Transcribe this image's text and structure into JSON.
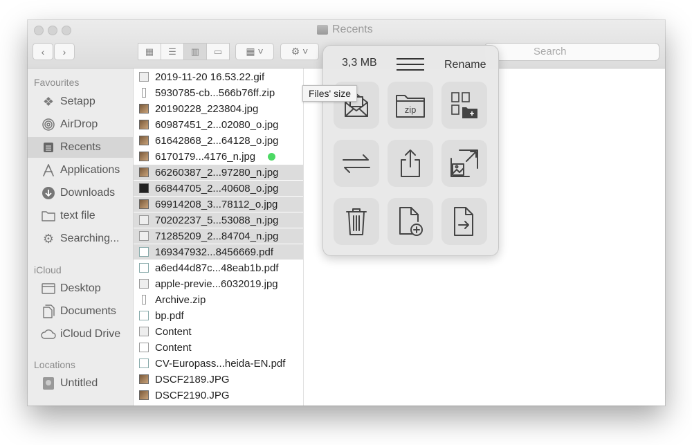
{
  "window": {
    "title": "Recents"
  },
  "toolbar": {
    "search_placeholder": "Search"
  },
  "sidebar": {
    "favourites_label": "Favourites",
    "favourites": [
      {
        "label": "Setapp",
        "icon": "setapp-icon"
      },
      {
        "label": "AirDrop",
        "icon": "airdrop-icon"
      },
      {
        "label": "Recents",
        "icon": "recents-icon",
        "selected": true
      },
      {
        "label": "Applications",
        "icon": "applications-icon"
      },
      {
        "label": "Downloads",
        "icon": "downloads-icon"
      },
      {
        "label": "text file",
        "icon": "folder-icon"
      },
      {
        "label": "Searching...",
        "icon": "gear-icon"
      }
    ],
    "icloud_label": "iCloud",
    "icloud": [
      {
        "label": "Desktop",
        "icon": "desktop-folder-icon"
      },
      {
        "label": "Documents",
        "icon": "documents-icon"
      },
      {
        "label": "iCloud Drive",
        "icon": "cloud-icon"
      }
    ],
    "locations_label": "Locations",
    "locations": [
      {
        "label": "Untitled",
        "icon": "disk-icon"
      }
    ]
  },
  "files": [
    {
      "name": "2019-11-20 16.53.22.gif",
      "kind": "doc"
    },
    {
      "name": "5930785-cb...566b76ff.zip",
      "kind": "zip"
    },
    {
      "name": "20190228_223804.jpg",
      "kind": "img"
    },
    {
      "name": "60987451_2...02080_o.jpg",
      "kind": "img"
    },
    {
      "name": "61642868_2...64128_o.jpg",
      "kind": "img"
    },
    {
      "name": "6170179...4176_n.jpg",
      "kind": "img",
      "tag": "green"
    },
    {
      "name": "66260387_2...97280_n.jpg",
      "kind": "img",
      "selected": true
    },
    {
      "name": "66844705_2...40608_o.jpg",
      "kind": "dark",
      "selected": true
    },
    {
      "name": "69914208_3...78112_o.jpg",
      "kind": "img",
      "selected": true
    },
    {
      "name": "70202237_5...53088_n.jpg",
      "kind": "doc",
      "selected": true
    },
    {
      "name": "71285209_2...84704_n.jpg",
      "kind": "doc",
      "selected": true
    },
    {
      "name": "169347932...8456669.pdf",
      "kind": "pdf",
      "selected": true
    },
    {
      "name": "a6ed44d87c...48eab1b.pdf",
      "kind": "pdf"
    },
    {
      "name": "apple-previe...6032019.jpg",
      "kind": "doc"
    },
    {
      "name": "Archive.zip",
      "kind": "zip"
    },
    {
      "name": "bp.pdf",
      "kind": "pdf"
    },
    {
      "name": "Content",
      "kind": "doc"
    },
    {
      "name": "Content",
      "kind": "doc"
    },
    {
      "name": "CV-Europass...heida-EN.pdf",
      "kind": "pdf"
    },
    {
      "name": "DSCF2189.JPG",
      "kind": "img"
    },
    {
      "name": "DSCF2190.JPG",
      "kind": "img"
    }
  ],
  "popup": {
    "size": "3,3 MB",
    "rename": "Rename",
    "tooltip": "Files' size",
    "zip_text": "zip",
    "actions": [
      {
        "icon": "mail-icon"
      },
      {
        "icon": "zip-folder-icon"
      },
      {
        "icon": "move-to-folder-icon"
      },
      {
        "icon": "convert-icon"
      },
      {
        "icon": "share-icon"
      },
      {
        "icon": "resize-image-icon"
      },
      {
        "icon": "trash-icon"
      },
      {
        "icon": "new-file-icon"
      },
      {
        "icon": "move-file-icon"
      }
    ]
  }
}
